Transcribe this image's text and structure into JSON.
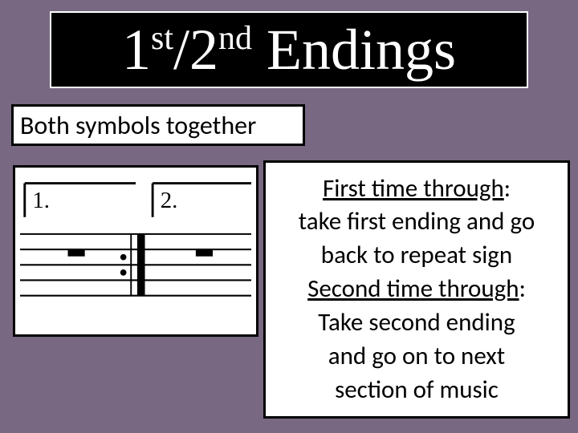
{
  "title": {
    "one": "1",
    "st": "st",
    "slash": "/",
    "two": "2",
    "nd": "nd",
    "heading": " Endings"
  },
  "subtitle": "Both symbols together",
  "notation": {
    "label1": "1.",
    "label2": "2."
  },
  "desc": {
    "line1u": "First time through",
    "line1c": ":",
    "line2": "take first ending and go",
    "line3": "back to repeat sign",
    "line4u": "Second time through",
    "line4c": ":",
    "line5": "Take second ending",
    "line6": "and go on to next",
    "line7": "section of music"
  }
}
